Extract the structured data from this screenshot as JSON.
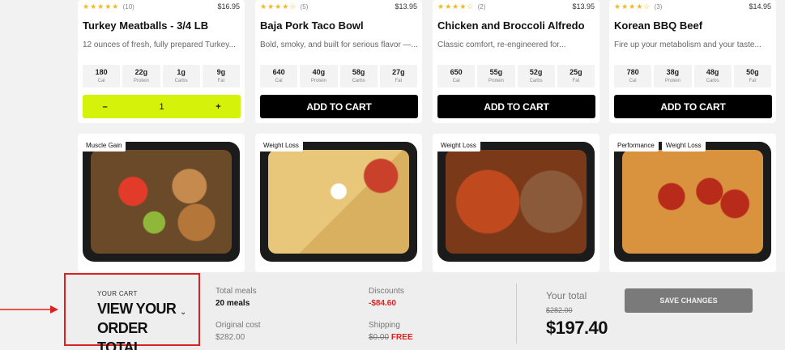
{
  "meals": [
    {
      "stars": "★★★★★",
      "rating_count": "(10)",
      "price": "$16.95",
      "name": "Turkey Meatballs - 3/4 LB",
      "desc": "12 ounces of fresh, fully prepared Turkey...",
      "macros": [
        {
          "val": "180",
          "lbl": "Cal"
        },
        {
          "val": "22g",
          "lbl": "Protein"
        },
        {
          "val": "1g",
          "lbl": "Carbs"
        },
        {
          "val": "9g",
          "lbl": "Fat"
        }
      ],
      "stepper": {
        "minus": "–",
        "qty": "1",
        "plus": "+"
      }
    },
    {
      "stars": "★★★★☆",
      "rating_count": "(5)",
      "price": "$13.95",
      "name": "Baja Pork Taco Bowl",
      "desc": "Bold, smoky, and built for serious flavor —...",
      "macros": [
        {
          "val": "640",
          "lbl": "Cal"
        },
        {
          "val": "40g",
          "lbl": "Protein"
        },
        {
          "val": "58g",
          "lbl": "Carbs"
        },
        {
          "val": "27g",
          "lbl": "Fat"
        }
      ],
      "cta": "ADD TO CART"
    },
    {
      "stars": "★★★★☆",
      "rating_count": "(2)",
      "price": "$13.95",
      "name": "Chicken and Broccoli Alfredo",
      "desc": "Classic comfort, re-engineered for...",
      "macros": [
        {
          "val": "650",
          "lbl": "Cal"
        },
        {
          "val": "55g",
          "lbl": "Protein"
        },
        {
          "val": "52g",
          "lbl": "Carbs"
        },
        {
          "val": "25g",
          "lbl": "Fat"
        }
      ],
      "cta": "ADD TO CART"
    },
    {
      "stars": "★★★★☆",
      "rating_count": "(3)",
      "price": "$14.95",
      "name": "Korean BBQ Beef",
      "desc": "Fire up your metabolism and your taste...",
      "macros": [
        {
          "val": "780",
          "lbl": "Cal"
        },
        {
          "val": "38g",
          "lbl": "Protein"
        },
        {
          "val": "48g",
          "lbl": "Carbs"
        },
        {
          "val": "50g",
          "lbl": "Fat"
        }
      ],
      "cta": "ADD TO CART"
    }
  ],
  "next_meals": [
    {
      "tags": [
        "Muscle Gain"
      ],
      "food_color": "#a65a2a"
    },
    {
      "tags": [
        "Weight Loss"
      ],
      "food_color": "#e0c070"
    },
    {
      "tags": [
        "Weight Loss"
      ],
      "food_color": "#b3471f"
    },
    {
      "tags": [
        "Performance",
        "Weight Loss"
      ],
      "food_color": "#d98a3a"
    }
  ],
  "footer": {
    "your_cart": "YOUR CART",
    "view_total": "VIEW YOUR ORDER TOTAL",
    "total_meals_lbl": "Total meals",
    "total_meals_val": "20 meals",
    "original_cost_lbl": "Original cost",
    "original_cost_val": "$282.00",
    "discounts_lbl": "Discounts",
    "discounts_val": "-$84.60",
    "shipping_lbl": "Shipping",
    "shipping_old": "$0.00",
    "shipping_new": "FREE",
    "your_total_lbl": "Your total",
    "old_total": "$282.00",
    "new_total": "$197.40",
    "save_label": "SAVE CHANGES"
  },
  "colors": {
    "accent": "#d4f20a",
    "discount": "#e02020",
    "annotation": "#e02020"
  }
}
